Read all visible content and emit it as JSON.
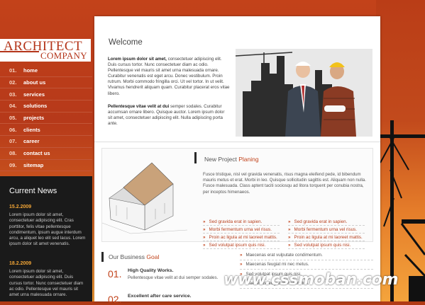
{
  "logo": {
    "line1": "ARCHITECT",
    "line2": "COMPANY"
  },
  "menu": [
    {
      "num": "01.",
      "label": "home"
    },
    {
      "num": "02.",
      "label": "about us"
    },
    {
      "num": "03.",
      "label": "services"
    },
    {
      "num": "04.",
      "label": "solutions"
    },
    {
      "num": "05.",
      "label": "projects"
    },
    {
      "num": "06.",
      "label": "clients"
    },
    {
      "num": "07.",
      "label": "career"
    },
    {
      "num": "08.",
      "label": "contact us"
    },
    {
      "num": "09.",
      "label": "sitemap"
    }
  ],
  "news": {
    "title": "Current News",
    "items": [
      {
        "date": "15.2.2009",
        "text": "Lorem ipsum dolor sit amet, consectetuer adipiscing elit. Cras porttitor, felis vitae pellentesque condimentum, ipsum augue interdum arcu, a aliquet leo elit sed lacus. Lorem ipsum dolor sit amet venenatis."
      },
      {
        "date": "18.2.2009",
        "text": "Lorem ipsum dolor sit amet, consectetuer adipiscing elit. Duis cursus tortor. Nunc consectetuer diam ac odio. Pellentesque vel mauris sit amet urna malesuada ornare."
      }
    ]
  },
  "welcome": {
    "title": "Welcome",
    "p1_bold": "Lorem ipsum dolor sit amet,",
    "p1": "consectetuer adipiscing elit. Duis cursus tortor. Nunc consectetuer diam ac odio. Pellentesque vel mauris sit amet urna malesuada ornare. Curabitur venenatis est eget arcu. Donec vestibulum. Proin rutrum. Morbi commodo fringilla orci. Ut vel tortor. In ut velit. Vivamus hendrerit aliquam quam. Curabitur placerat eros vitae libero.",
    "p2_bold": "Pellentesque vitae velit at dui",
    "p2": "semper sodales. Curabitur accumsan ornare libero. Quisque auctor. Lorem ipsum dolor sit amet, consectetuer adipiscing elit. Nulla adipiscing porta ante."
  },
  "project": {
    "title_a": "New Project ",
    "title_b": "Planing",
    "text": "Fusce tristique, nisl vel gravida venenatis, risus magna eleifend pede, id bibendum mauris metus et erat. Morbi in leo. Quisque sollicitudin sagittis est. Aliquam non nulla. Fusce malesuada. Class aptent taciti sociosqu ad litora torquent per conubia nostra, per inceptos himenaeos.",
    "links_left": [
      "Sed gravida erat in sapien.",
      "Morbi fermentum urna vel risus.",
      "Proin ac ligula at mi laoreet mattis.",
      "Sed volutpat ipsum quis nisi."
    ],
    "links_right": [
      "Sed gravida erat in sapien.",
      "Morbi fermentum urna vel risus.",
      "Proin ac ligula at mi laoreet mattis.",
      "Sed volutpat ipsum quis nisi."
    ]
  },
  "business": {
    "title_a": "Our Business ",
    "title_b": "Goal",
    "rows": [
      {
        "num": "01.",
        "head": "High Quality Works.",
        "sub": "Pellentesque vitae velit at dui semper sodales."
      },
      {
        "num": "02.",
        "head": "Excellent after care service.",
        "sub": ""
      }
    ],
    "list": [
      "Maecenas erat vulputate condimentum.",
      "Maecenas feugiat mi nec metus.",
      "Sed volutpat ipsum quis nisi.",
      "Maecenas feugiat mi nec metus."
    ]
  },
  "watermark": {
    "a": "www.css",
    "b": "moban",
    "c": ".com"
  },
  "colors": {
    "accent": "#c2441c",
    "sidebar": "#b13a15",
    "news_bg": "#1a1a1a",
    "news_date": "#f3a636"
  }
}
